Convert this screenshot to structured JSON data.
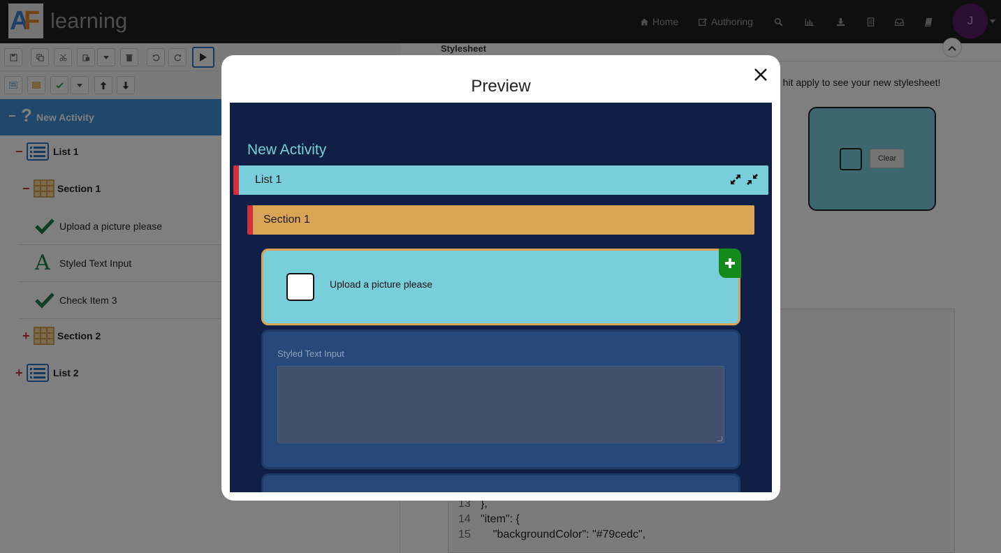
{
  "app": {
    "logo_text": "learning",
    "nav": {
      "home": "Home",
      "authoring": "Authoring"
    },
    "user_initial": "J"
  },
  "tree": {
    "root": "New Activity",
    "items": [
      {
        "label": "List 1"
      },
      {
        "label": "Section 1"
      },
      {
        "label": "Upload a picture please"
      },
      {
        "label": "Styled Text Input"
      },
      {
        "label": "Check Item 3"
      },
      {
        "label": "Section 2"
      },
      {
        "label": "List 2"
      }
    ]
  },
  "right": {
    "stylesheet_label": "Stylesheet",
    "hint": "d hit apply to see your new stylesheet!",
    "clear_label": "Clear",
    "code": {
      "line_numbers": [
        "13",
        "14",
        "15"
      ],
      "lines": [
        "},",
        "\"item\": {",
        "    \"backgroundColor\": \"#79cedc\","
      ]
    }
  },
  "modal": {
    "title": "Preview",
    "activity_title": "New Activity",
    "list_label": "List 1",
    "section_label": "Section 1",
    "upload_label": "Upload a picture please",
    "text_input_label": "Styled Text Input"
  },
  "colors": {
    "list_bar": "#79cedc",
    "section_bar": "#d9a455",
    "accent_red": "#d1303c",
    "preview_bg": "#0f1f45",
    "add_badge": "#138a1a"
  }
}
